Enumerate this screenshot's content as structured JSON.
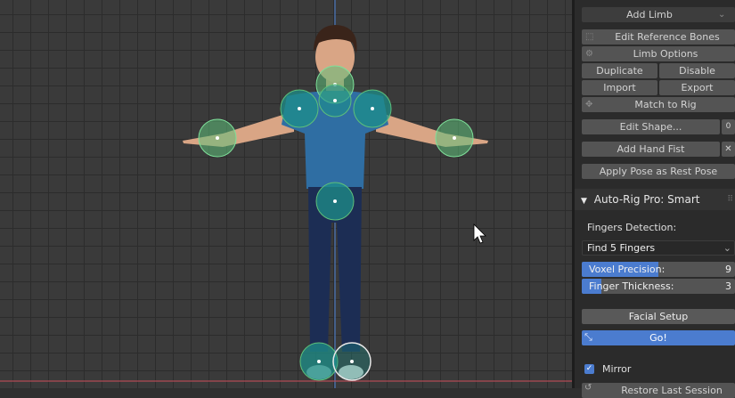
{
  "panel": {
    "add_limb": "Add Limb",
    "edit_reference_bones": "Edit Reference Bones",
    "limb_options": "Limb Options",
    "duplicate": "Duplicate",
    "disable": "Disable",
    "import": "Import",
    "export": "Export",
    "match_to_rig": "Match to Rig",
    "edit_shape": "Edit Shape...",
    "add_hand_fist": "Add Hand Fist",
    "apply_pose": "Apply Pose as Rest Pose",
    "edit_shape_side": "0"
  },
  "smart": {
    "header": "Auto-Rig Pro: Smart",
    "fingers_detection_label": "Fingers Detection:",
    "fingers_dropdown": "Find 5 Fingers",
    "voxel_precision_label": "Voxel Precision:",
    "voxel_precision_value": "9",
    "voxel_precision_fill": 0.5,
    "finger_thickness_label": "Finger Thickness:",
    "finger_thickness_value": "3",
    "finger_thickness_fill": 0.13,
    "facial_setup": "Facial Setup",
    "go": "Go!",
    "mirror": "Mirror",
    "mirror_checked": true,
    "restore_last": "Restore Last Session"
  },
  "colors": {
    "accent": "#4b7ccf",
    "marker_green": "#5ec07a",
    "marker_teal": "#1e8f8a"
  }
}
